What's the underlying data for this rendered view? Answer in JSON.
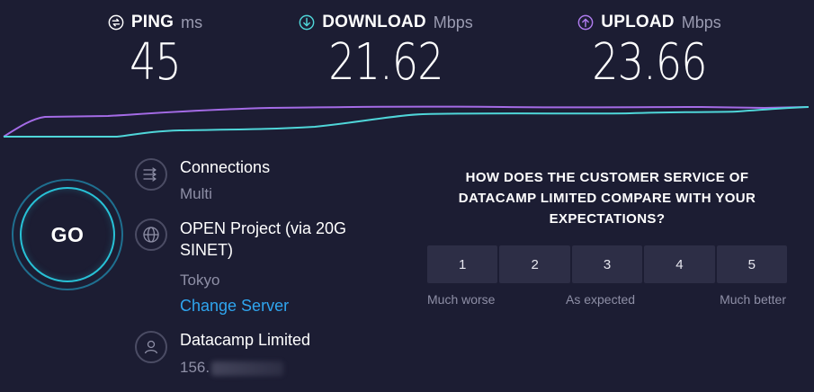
{
  "metrics": {
    "ping": {
      "label": "PING",
      "unit": "ms",
      "value": "45",
      "color": "#ffffff"
    },
    "download": {
      "label": "DOWNLOAD",
      "unit": "Mbps",
      "value": "21.62",
      "color": "#4fd6d9"
    },
    "upload": {
      "label": "UPLOAD",
      "unit": "Mbps",
      "value": "23.66",
      "color": "#b07cf0"
    }
  },
  "colors": {
    "background": "#1c1d33",
    "download_line": "#4fd6d9",
    "upload_line": "#a46be6",
    "link": "#2fa5ef",
    "rating_button": "#2d2e46"
  },
  "go_button": {
    "label": "GO"
  },
  "connections": {
    "title": "Connections",
    "mode": "Multi",
    "icon": "connections-arrows-icon"
  },
  "server": {
    "name": "OPEN Project (via 20G SINET)",
    "location": "Tokyo",
    "change_link": "Change Server",
    "icon": "globe-icon"
  },
  "provider": {
    "name": "Datacamp Limited",
    "ip_visible": "156.",
    "icon": "user-icon"
  },
  "survey": {
    "question": "HOW DOES THE CUSTOMER SERVICE OF DATACAMP LIMITED COMPARE WITH YOUR EXPECTATIONS?",
    "options": [
      "1",
      "2",
      "3",
      "4",
      "5"
    ],
    "scale_low": "Much worse",
    "scale_mid": "As expected",
    "scale_high": "Much better"
  }
}
